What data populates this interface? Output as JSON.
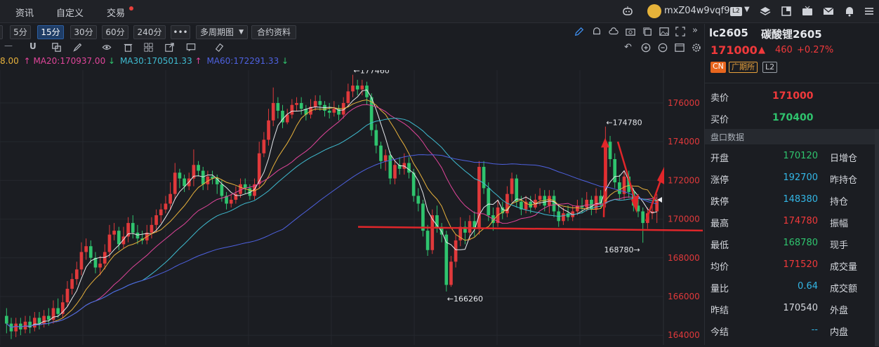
{
  "nav": {
    "items": [
      "资讯",
      "自定义",
      "交易"
    ]
  },
  "user": {
    "name": "mxZ04w9vqf9",
    "level": "L2"
  },
  "toolbar": {
    "timeframes": [
      "5分",
      "15分",
      "30分",
      "60分",
      "240分"
    ],
    "active": "15分",
    "more": "•••",
    "multi_chart": "多周期图",
    "contract_info": "合约资料"
  },
  "ma": {
    "first": "8.00",
    "ma20": "MA20:170937.00",
    "ma30": "MA30:170501.33",
    "ma60": "MA60:172291.33",
    "colors": {
      "first": "#e8b23c",
      "ma20": "#e0459a",
      "ma30": "#3fbcd1",
      "ma60": "#4e61e0"
    }
  },
  "chart_data": {
    "type": "candlestick",
    "y_ticks": [
      "176000",
      "174000",
      "172000",
      "170000",
      "168000",
      "166000",
      "164000"
    ],
    "ylim": [
      163500,
      177700
    ],
    "annotations": {
      "high": "←177460",
      "high2": "←174780",
      "low": "←166260",
      "low2": "168780→"
    },
    "last_price": 171000,
    "candles": [
      [
        165000,
        164600,
        165400,
        164100
      ],
      [
        164600,
        164200,
        164900,
        163800
      ],
      [
        164200,
        164600,
        164900,
        163900
      ],
      [
        164600,
        164300,
        164900,
        164000
      ],
      [
        164300,
        164700,
        165000,
        164100
      ],
      [
        164700,
        164400,
        165000,
        164100
      ],
      [
        164400,
        164900,
        165200,
        164200
      ],
      [
        164900,
        164600,
        165200,
        164300
      ],
      [
        164600,
        165000,
        165300,
        164400
      ],
      [
        165000,
        164800,
        165400,
        164500
      ],
      [
        164800,
        165400,
        165800,
        164600
      ],
      [
        165400,
        165100,
        165900,
        164900
      ],
      [
        165100,
        165700,
        166100,
        164900
      ],
      [
        165700,
        166400,
        166800,
        165500
      ],
      [
        166400,
        166900,
        167200,
        166100
      ],
      [
        166900,
        167400,
        167800,
        166600
      ],
      [
        167400,
        168300,
        168800,
        167100
      ],
      [
        168300,
        168600,
        169000,
        167900
      ],
      [
        168600,
        168000,
        168900,
        167700
      ],
      [
        168000,
        167500,
        168300,
        167200
      ],
      [
        167500,
        167700,
        168100,
        167100
      ],
      [
        167700,
        168300,
        168700,
        167400
      ],
      [
        168300,
        169200,
        169700,
        168000
      ],
      [
        169200,
        169400,
        169800,
        168900
      ],
      [
        169400,
        168700,
        169600,
        168400
      ],
      [
        168700,
        169100,
        169600,
        168500
      ],
      [
        169100,
        169800,
        170100,
        168800
      ],
      [
        169800,
        169300,
        170200,
        169000
      ],
      [
        169300,
        169000,
        169700,
        168700
      ],
      [
        169000,
        168900,
        169400,
        168700
      ],
      [
        168900,
        169300,
        169700,
        168700
      ],
      [
        169300,
        169700,
        170100,
        169000
      ],
      [
        169700,
        170200,
        170500,
        169300
      ],
      [
        170200,
        170500,
        170800,
        169800
      ],
      [
        170500,
        170800,
        171200,
        170300
      ],
      [
        170800,
        171300,
        171900,
        170500
      ],
      [
        171300,
        172400,
        172900,
        171000
      ],
      [
        172400,
        172100,
        172600,
        171600
      ],
      [
        172100,
        171700,
        172300,
        171400
      ],
      [
        171700,
        172100,
        172400,
        171500
      ],
      [
        172100,
        172800,
        173600,
        171700
      ],
      [
        172800,
        172500,
        173000,
        172200
      ],
      [
        172500,
        171800,
        172700,
        171500
      ],
      [
        171800,
        172200,
        172500,
        171500
      ],
      [
        172200,
        172100,
        172500,
        171800
      ],
      [
        172100,
        171800,
        172300,
        171300
      ],
      [
        171800,
        171200,
        172000,
        170900
      ],
      [
        171200,
        170800,
        171400,
        170500
      ],
      [
        170800,
        171000,
        171300,
        170600
      ],
      [
        171000,
        171300,
        171700,
        170800
      ],
      [
        171300,
        171800,
        172100,
        171100
      ],
      [
        171800,
        171600,
        172100,
        171300
      ],
      [
        171600,
        171200,
        171800,
        171000
      ],
      [
        171200,
        171800,
        172100,
        171000
      ],
      [
        171800,
        173400,
        174000,
        171600
      ],
      [
        173400,
        174100,
        174500,
        173200
      ],
      [
        174100,
        175100,
        175700,
        173800
      ],
      [
        175100,
        176000,
        176800,
        174800
      ],
      [
        176000,
        175600,
        176300,
        175200
      ],
      [
        175600,
        175000,
        175900,
        174700
      ],
      [
        175000,
        175400,
        175700,
        174900
      ],
      [
        175400,
        175900,
        176200,
        175200
      ],
      [
        175900,
        176000,
        176300,
        175600
      ],
      [
        176000,
        175700,
        176300,
        175400
      ],
      [
        175700,
        175400,
        175900,
        175100
      ],
      [
        175400,
        175800,
        176200,
        175200
      ],
      [
        175800,
        176100,
        176400,
        175600
      ],
      [
        176100,
        175900,
        176400,
        175600
      ],
      [
        175900,
        175600,
        176100,
        175300
      ],
      [
        175600,
        175500,
        176000,
        175200
      ],
      [
        175500,
        175700,
        176100,
        175300
      ],
      [
        175700,
        175400,
        175900,
        175100
      ],
      [
        175400,
        176000,
        176300,
        175200
      ],
      [
        176000,
        176600,
        177000,
        175800
      ],
      [
        176600,
        176900,
        177460,
        176300
      ],
      [
        176900,
        176700,
        177200,
        176400
      ],
      [
        176700,
        176900,
        177200,
        176400
      ],
      [
        176900,
        176300,
        177100,
        175900
      ],
      [
        176300,
        174600,
        176500,
        174300
      ],
      [
        174600,
        173800,
        174900,
        173400
      ],
      [
        173800,
        173000,
        174000,
        172600
      ],
      [
        173000,
        173300,
        173600,
        172500
      ],
      [
        173300,
        172100,
        173500,
        171800
      ],
      [
        172100,
        172800,
        173100,
        171800
      ],
      [
        172800,
        172600,
        173200,
        172300
      ],
      [
        172600,
        172900,
        173400,
        172300
      ],
      [
        172900,
        172400,
        173200,
        172100
      ],
      [
        172400,
        171200,
        172600,
        170900
      ],
      [
        171200,
        170800,
        171600,
        170400
      ],
      [
        170800,
        169400,
        171000,
        169100
      ],
      [
        169400,
        168400,
        169700,
        168100
      ],
      [
        168400,
        170200,
        170500,
        168200
      ],
      [
        170200,
        169600,
        170700,
        169300
      ],
      [
        169600,
        169200,
        169800,
        168800
      ],
      [
        169200,
        166600,
        169400,
        166260
      ],
      [
        166600,
        167800,
        168100,
        166500
      ],
      [
        167800,
        168900,
        169200,
        167500
      ],
      [
        168900,
        169600,
        170100,
        168600
      ],
      [
        169600,
        169300,
        169900,
        168700
      ],
      [
        169300,
        169900,
        170200,
        168900
      ],
      [
        169900,
        169500,
        170400,
        169100
      ],
      [
        169500,
        172700,
        173000,
        169200
      ],
      [
        172700,
        171600,
        173000,
        171300
      ],
      [
        171600,
        170200,
        171900,
        169900
      ],
      [
        170200,
        169800,
        170600,
        169400
      ],
      [
        169800,
        170600,
        171000,
        169600
      ],
      [
        170600,
        170300,
        170900,
        170000
      ],
      [
        170300,
        171300,
        171700,
        170100
      ],
      [
        171300,
        172100,
        172400,
        170900
      ],
      [
        172100,
        170900,
        172300,
        170600
      ],
      [
        170900,
        170500,
        171200,
        170200
      ],
      [
        170500,
        170900,
        171200,
        170300
      ],
      [
        170900,
        170600,
        171200,
        170300
      ],
      [
        170600,
        171000,
        171300,
        170500
      ],
      [
        171000,
        171200,
        171600,
        170700
      ],
      [
        171200,
        170700,
        171500,
        170400
      ],
      [
        170700,
        171200,
        171500,
        170300
      ],
      [
        171200,
        170400,
        171500,
        170100
      ],
      [
        170400,
        169900,
        170800,
        169600
      ],
      [
        169900,
        170300,
        170600,
        169700
      ],
      [
        170300,
        170100,
        170700,
        169900
      ],
      [
        170100,
        170400,
        170700,
        169900
      ],
      [
        170400,
        170700,
        171000,
        170200
      ],
      [
        170700,
        170600,
        171100,
        170300
      ],
      [
        170600,
        171000,
        171400,
        170400
      ],
      [
        171000,
        170500,
        171200,
        170200
      ],
      [
        170500,
        171200,
        171600,
        170300
      ],
      [
        171200,
        170800,
        171500,
        170600
      ],
      [
        170800,
        174000,
        174780,
        170600
      ],
      [
        174000,
        173100,
        174300,
        172700
      ],
      [
        173100,
        171900,
        173400,
        171600
      ],
      [
        171900,
        171300,
        172300,
        171000
      ],
      [
        171300,
        172200,
        172500,
        171000
      ],
      [
        172200,
        171400,
        172500,
        171100
      ],
      [
        171400,
        170700,
        171600,
        170400
      ],
      [
        170700,
        170400,
        171000,
        170100
      ],
      [
        170400,
        169800,
        170600,
        168780
      ],
      [
        169800,
        170300,
        170600,
        169500
      ],
      [
        170300,
        170400,
        170800,
        170000
      ],
      [
        170400,
        171000,
        171300,
        169800
      ]
    ]
  },
  "symbol": {
    "code": "lc2605",
    "name": "碳酸锂2605",
    "price": "171000",
    "arrow": "🡅",
    "change": "460",
    "pct": "+0.27%",
    "tags": [
      "CN",
      "广期所",
      "L2"
    ]
  },
  "quote": {
    "ask_label": "卖价",
    "ask": "171000",
    "bid_label": "买价",
    "bid": "170400"
  },
  "section": "盘口数据",
  "rows": [
    {
      "l": "开盘",
      "v": "170120",
      "c": "#2fc46e",
      "r": "日增仓"
    },
    {
      "l": "涨停",
      "v": "192700",
      "c": "#33b6e5",
      "r": "昨持仓"
    },
    {
      "l": "跌停",
      "v": "148380",
      "c": "#33b6e5",
      "r": "持仓"
    },
    {
      "l": "最高",
      "v": "174780",
      "c": "#f0393b",
      "r": "振幅"
    },
    {
      "l": "最低",
      "v": "168780",
      "c": "#2fc46e",
      "r": "现手"
    },
    {
      "l": "均价",
      "v": "171520",
      "c": "#f0393b",
      "r": "成交量"
    },
    {
      "l": "量比",
      "v": "0.64",
      "c": "#33b6e5",
      "r": "成交额"
    },
    {
      "l": "昨结",
      "v": "170540",
      "c": "#d5d8de",
      "r": "外盘"
    },
    {
      "l": "今结",
      "v": "--",
      "c": "#33b6e5",
      "r": "内盘"
    }
  ]
}
